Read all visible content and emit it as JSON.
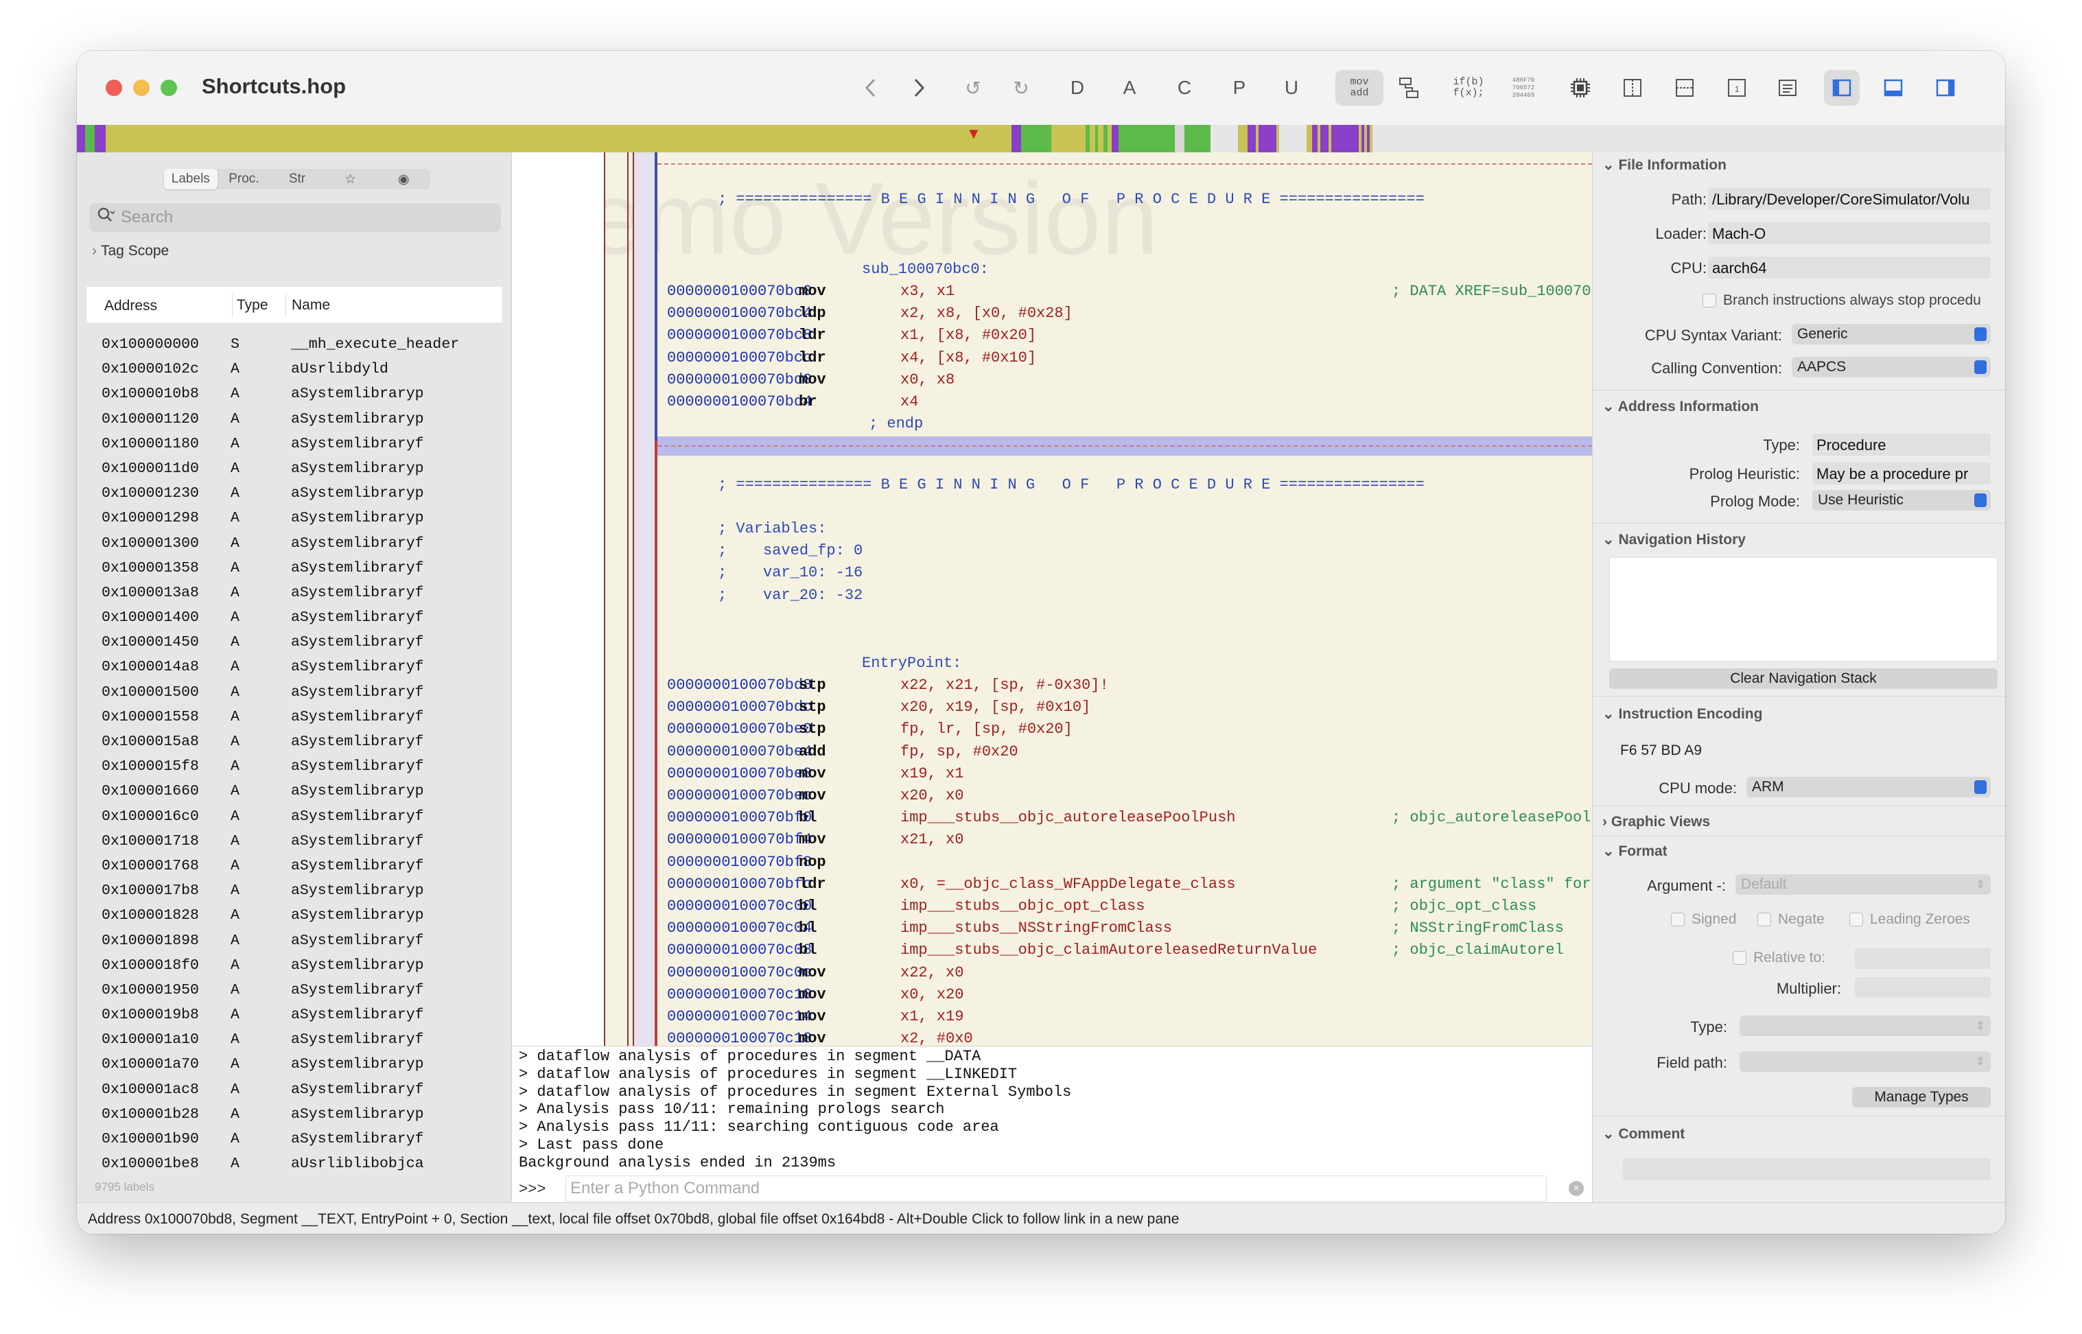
{
  "window": {
    "title": "Shortcuts.hop"
  },
  "toolbar": {
    "btn_d": "D",
    "btn_a": "A",
    "btn_c": "C",
    "btn_p": "P",
    "btn_u": "U",
    "mov_line1": "mov",
    "mov_line2": "add",
    "if_line1": "if(b)",
    "if_line2": "f(x);",
    "hex_line1": "486F70",
    "hex_line2": "706572",
    "hex_line3": "204469"
  },
  "left": {
    "tabs": [
      "Labels",
      "Proc.",
      "Str",
      "☆",
      "◉"
    ],
    "search_placeholder": "Search",
    "tag_scope": "Tag Scope",
    "columns": [
      "Address",
      "Type",
      "Name"
    ],
    "rows": [
      [
        "0x100000000",
        "S",
        "__mh_execute_header"
      ],
      [
        "0x10000102c",
        "A",
        "aUsrlibdyld"
      ],
      [
        "0x1000010b8",
        "A",
        "aSystemlibraryp"
      ],
      [
        "0x100001120",
        "A",
        "aSystemlibraryp"
      ],
      [
        "0x100001180",
        "A",
        "aSystemlibraryf"
      ],
      [
        "0x1000011d0",
        "A",
        "aSystemlibraryp"
      ],
      [
        "0x100001230",
        "A",
        "aSystemlibraryp"
      ],
      [
        "0x100001298",
        "A",
        "aSystemlibraryp"
      ],
      [
        "0x100001300",
        "A",
        "aSystemlibraryf"
      ],
      [
        "0x100001358",
        "A",
        "aSystemlibraryf"
      ],
      [
        "0x1000013a8",
        "A",
        "aSystemlibraryf"
      ],
      [
        "0x100001400",
        "A",
        "aSystemlibraryf"
      ],
      [
        "0x100001450",
        "A",
        "aSystemlibraryf"
      ],
      [
        "0x1000014a8",
        "A",
        "aSystemlibraryf"
      ],
      [
        "0x100001500",
        "A",
        "aSystemlibraryf"
      ],
      [
        "0x100001558",
        "A",
        "aSystemlibraryf"
      ],
      [
        "0x1000015a8",
        "A",
        "aSystemlibraryf"
      ],
      [
        "0x1000015f8",
        "A",
        "aSystemlibraryf"
      ],
      [
        "0x100001660",
        "A",
        "aSystemlibraryp"
      ],
      [
        "0x1000016c0",
        "A",
        "aSystemlibraryf"
      ],
      [
        "0x100001718",
        "A",
        "aSystemlibraryf"
      ],
      [
        "0x100001768",
        "A",
        "aSystemlibraryf"
      ],
      [
        "0x1000017b8",
        "A",
        "aSystemlibraryp"
      ],
      [
        "0x100001828",
        "A",
        "aSystemlibraryp"
      ],
      [
        "0x100001898",
        "A",
        "aSystemlibraryf"
      ],
      [
        "0x1000018f0",
        "A",
        "aSystemlibraryp"
      ],
      [
        "0x100001950",
        "A",
        "aSystemlibraryf"
      ],
      [
        "0x1000019b8",
        "A",
        "aSystemlibraryf"
      ],
      [
        "0x100001a10",
        "A",
        "aSystemlibraryf"
      ],
      [
        "0x100001a70",
        "A",
        "aSystemlibraryp"
      ],
      [
        "0x100001ac8",
        "A",
        "aSystemlibraryf"
      ],
      [
        "0x100001b28",
        "A",
        "aSystemlibraryp"
      ],
      [
        "0x100001b90",
        "A",
        "aSystemlibraryf"
      ],
      [
        "0x100001be8",
        "A",
        "aUsrliblibobjca"
      ]
    ],
    "footer": "9795 labels"
  },
  "code": {
    "watermark": "Demo Version",
    "banner1": "; =============== B E G I N N I N G   O F   P R O C E D U R E ================",
    "proc1_label": "sub_100070bc0:",
    "proc1_lines": [
      {
        "addr": "0000000100070bc0",
        "mn": "mov",
        "ops": "x3, x1",
        "cmt": "; DATA XREF=sub_100070"
      },
      {
        "addr": "0000000100070bc4",
        "mn": "ldp",
        "ops": "x2, x8, [x0, #0x28]",
        "cmt": ""
      },
      {
        "addr": "0000000100070bc8",
        "mn": "ldr",
        "ops": "x1, [x8, #0x20]",
        "cmt": ""
      },
      {
        "addr": "0000000100070bcc",
        "mn": "ldr",
        "ops": "x4, [x8, #0x10]",
        "cmt": ""
      },
      {
        "addr": "0000000100070bd0",
        "mn": "mov",
        "ops": "x0, x8",
        "cmt": ""
      },
      {
        "addr": "0000000100070bd4",
        "mn": "br",
        "ops": "x4",
        "cmt": ""
      }
    ],
    "endp": "; endp",
    "banner2": "; =============== B E G I N N I N G   O F   P R O C E D U R E ================",
    "vars": [
      "; Variables:",
      ";    saved_fp: 0",
      ";    var_10: -16",
      ";    var_20: -32"
    ],
    "proc2_label": "EntryPoint:",
    "proc2_lines": [
      {
        "addr": "0000000100070bd8",
        "mn": "stp",
        "ops": "x22, x21, [sp, #-0x30]!",
        "cmt": ""
      },
      {
        "addr": "0000000100070bdc",
        "mn": "stp",
        "ops": "x20, x19, [sp, #0x10]",
        "cmt": ""
      },
      {
        "addr": "0000000100070be0",
        "mn": "stp",
        "ops": "fp, lr, [sp, #0x20]",
        "cmt": ""
      },
      {
        "addr": "0000000100070be4",
        "mn": "add",
        "ops": "fp, sp, #0x20",
        "cmt": ""
      },
      {
        "addr": "0000000100070be8",
        "mn": "mov",
        "ops": "x19, x1",
        "cmt": ""
      },
      {
        "addr": "0000000100070bec",
        "mn": "mov",
        "ops": "x20, x0",
        "cmt": ""
      },
      {
        "addr": "0000000100070bf0",
        "mn": "bl",
        "ops": "imp___stubs__objc_autoreleasePoolPush",
        "cmt": "; objc_autoreleasePool"
      },
      {
        "addr": "0000000100070bf4",
        "mn": "mov",
        "ops": "x21, x0",
        "cmt": ""
      },
      {
        "addr": "0000000100070bf8",
        "mn": "nop",
        "ops": "",
        "cmt": ""
      },
      {
        "addr": "0000000100070bfc",
        "mn": "ldr",
        "ops": "x0, =__objc_class_WFAppDelegate_class",
        "cmt": "; argument \"class\" for"
      },
      {
        "addr": "0000000100070c00",
        "mn": "bl",
        "ops": "imp___stubs__objc_opt_class",
        "cmt": "; objc_opt_class"
      },
      {
        "addr": "0000000100070c04",
        "mn": "bl",
        "ops": "imp___stubs__NSStringFromClass",
        "cmt": "; NSStringFromClass"
      },
      {
        "addr": "0000000100070c08",
        "mn": "bl",
        "ops": "imp___stubs__objc_claimAutoreleasedReturnValue",
        "cmt": "; objc_claimAutorel"
      },
      {
        "addr": "0000000100070c0c",
        "mn": "mov",
        "ops": "x22, x0",
        "cmt": ""
      },
      {
        "addr": "0000000100070c10",
        "mn": "mov",
        "ops": "x0, x20",
        "cmt": ""
      },
      {
        "addr": "0000000100070c14",
        "mn": "mov",
        "ops": "x1, x19",
        "cmt": ""
      },
      {
        "addr": "0000000100070c18",
        "mn": "mov",
        "ops": "x2, #0x0",
        "cmt": ""
      }
    ]
  },
  "console": {
    "lines": [
      "> dataflow analysis of procedures in segment __DATA",
      "> dataflow analysis of procedures in segment __LINKEDIT",
      "> dataflow analysis of procedures in segment External Symbols",
      "> Analysis pass 10/11: remaining prologs search",
      "> Analysis pass 11/11: searching contiguous code area",
      "> Last pass done",
      "Background analysis ended in 2139ms"
    ],
    "prompt": ">>>",
    "input_placeholder": "Enter a Python Command"
  },
  "inspector": {
    "file_info": {
      "title": "File Information",
      "path_label": "Path:",
      "path_value": "/Library/Developer/CoreSimulator/Volu",
      "loader_label": "Loader:",
      "loader_value": "Mach-O",
      "cpu_label": "CPU:",
      "cpu_value": "aarch64",
      "branch_text": "Branch instructions always stop procedu",
      "syntax_label": "CPU Syntax Variant:",
      "syntax_value": "Generic",
      "calling_label": "Calling Convention:",
      "calling_value": "AAPCS"
    },
    "address_info": {
      "title": "Address Information",
      "type_label": "Type:",
      "type_value": "Procedure",
      "heuristic_label": "Prolog Heuristic:",
      "heuristic_value": "May be a procedure pr",
      "mode_label": "Prolog Mode:",
      "mode_value": "Use Heuristic"
    },
    "nav_history": {
      "title": "Navigation History",
      "clear_button": "Clear Navigation Stack"
    },
    "encoding": {
      "title": "Instruction Encoding",
      "bytes": "F6 57 BD A9",
      "cpu_mode_label": "CPU mode:",
      "cpu_mode_value": "ARM"
    },
    "graphic_views": {
      "title": "Graphic Views"
    },
    "format": {
      "title": "Format",
      "argument_label": "Argument -:",
      "argument_value": "Default",
      "signed": "Signed",
      "negate": "Negate",
      "leading_zeroes": "Leading Zeroes",
      "relative_label": "Relative to:",
      "multiplier_label": "Multiplier:",
      "type_label": "Type:",
      "field_path_label": "Field path:",
      "manage_types": "Manage Types"
    },
    "comment": {
      "title": "Comment"
    }
  },
  "status_bar": "Address 0x100070bd8, Segment __TEXT, EntryPoint + 0, Section __text, local file offset 0x70bd8, global file offset 0x164bd8 - Alt+Double Click to follow link in a new pane",
  "colors": {
    "accent": "#2f6fdf",
    "minimap": "#c9c354",
    "code_bg": "#f5f2e2",
    "highlight": "#b9b9ea"
  }
}
